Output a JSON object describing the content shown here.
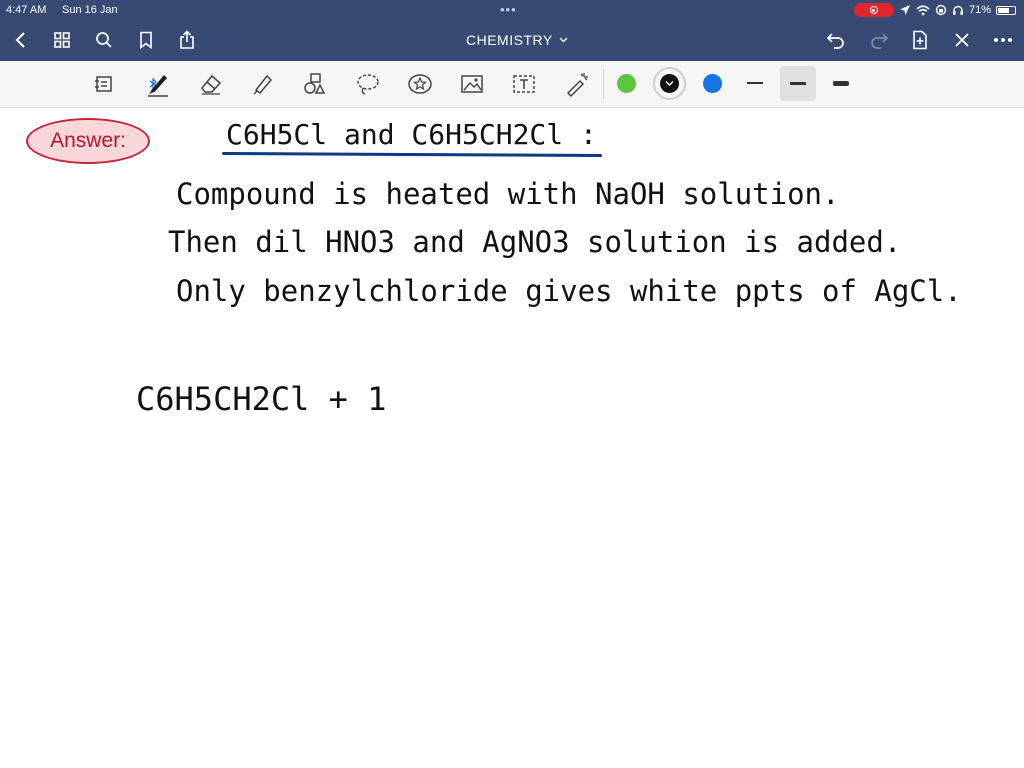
{
  "status_bar": {
    "time": "4:47 AM",
    "date": "Sun 16 Jan",
    "battery": "71%",
    "battery_level": 0.71
  },
  "header": {
    "title": "CHEMISTRY"
  },
  "toolbar": {
    "colors": [
      "#5cc63e",
      "#111111",
      "#1573e8"
    ]
  },
  "canvas": {
    "answer_label": "Answer:",
    "heading": "C6H5Cl and C6H5CH2Cl :",
    "line1": "Compound is heated with NaOH solution.",
    "line2": "Then dil HNO3 and AgNO3 solution is added.",
    "line3": "Only benzylchloride gives white ppts of AgCl.",
    "line4": "C6H5CH2Cl + 1"
  }
}
